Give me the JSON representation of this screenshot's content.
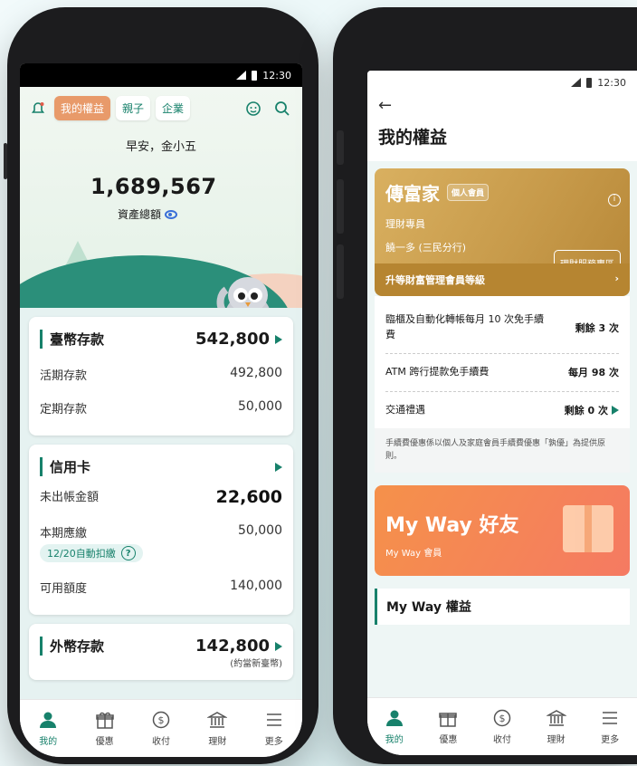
{
  "status": {
    "time": "12:30"
  },
  "left": {
    "nav": {
      "tabs": [
        "我的權益",
        "親子",
        "企業"
      ],
      "active": 0
    },
    "greeting": "早安，金小五",
    "total_assets": "1,689,567",
    "total_assets_label": "資產總額",
    "cards": {
      "deposit": {
        "title": "臺幣存款",
        "amount": "542,800",
        "rows": [
          {
            "label": "活期存款",
            "value": "492,800"
          },
          {
            "label": "定期存款",
            "value": "50,000"
          }
        ]
      },
      "credit": {
        "title": "信用卡",
        "unbilled_label": "未出帳金額",
        "unbilled_value": "22,600",
        "due_label": "本期應繳",
        "due_value": "50,000",
        "autopay": "12/20自動扣繳",
        "available_label": "可用額度",
        "available_value": "140,000"
      },
      "foreign": {
        "title": "外幣存款",
        "amount": "142,800",
        "sub": "(約當新臺幣)"
      }
    },
    "tabbar": [
      {
        "label": "我的",
        "icon": "person-icon"
      },
      {
        "label": "優惠",
        "icon": "gift-icon"
      },
      {
        "label": "收付",
        "icon": "dollar-coin-icon"
      },
      {
        "label": "理財",
        "icon": "bank-icon"
      },
      {
        "label": "更多",
        "icon": "menu-icon"
      }
    ]
  },
  "right": {
    "title": "我的權益",
    "gold_card": {
      "name": "傳富家",
      "tag": "個人會員",
      "advisor_label": "理財專員",
      "advisor_name": "饒一多 (三民分行)",
      "service_button": "理財服務專區",
      "upgrade": "升等財富管理會員等級"
    },
    "benefits": [
      {
        "label": "臨櫃及自動化轉帳每月 10 次免手續費",
        "value": "剩餘 3 次"
      },
      {
        "label": "ATM 跨行提款免手續費",
        "value": "每月 98 次"
      },
      {
        "label": "交通禮遇",
        "value": "剩餘 0 次"
      }
    ],
    "note": "手續費優惠係以個人及家庭會員手續費優惠「孰優」為提供原則。",
    "myway": {
      "title": "My Way 好友",
      "sub": "My Way 會員",
      "section": "My Way 權益"
    },
    "tabbar": [
      {
        "label": "我的"
      },
      {
        "label": "優惠"
      },
      {
        "label": "收付"
      },
      {
        "label": "理財"
      },
      {
        "label": "更多"
      }
    ]
  },
  "colors": {
    "brand": "#17816b",
    "accent": "#e89a6a",
    "gold": "#c79a4a",
    "orange": "#f5914a"
  }
}
